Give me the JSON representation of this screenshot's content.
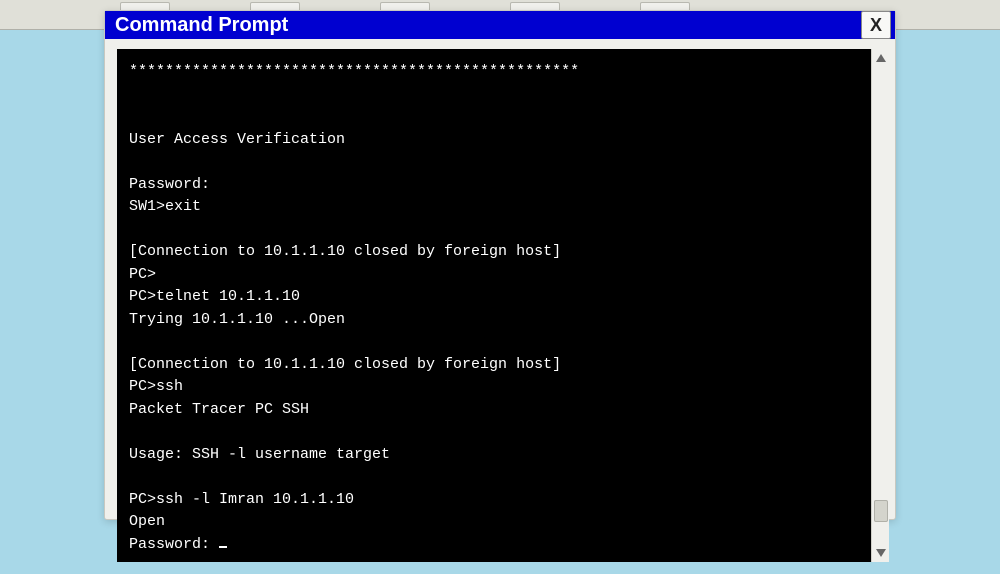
{
  "window": {
    "title": "Command Prompt",
    "close_label": "X"
  },
  "terminal": {
    "lines": [
      "**************************************************",
      "",
      "",
      "User Access Verification",
      "",
      "Password:",
      "SW1>exit",
      "",
      "[Connection to 10.1.1.10 closed by foreign host]",
      "PC>",
      "PC>telnet 10.1.1.10",
      "Trying 10.1.1.10 ...Open",
      "",
      "[Connection to 10.1.1.10 closed by foreign host]",
      "PC>ssh",
      "Packet Tracer PC SSH",
      "",
      "Usage: SSH -l username target",
      "",
      "PC>ssh -l Imran 10.1.1.10",
      "Open",
      "Password: "
    ]
  }
}
